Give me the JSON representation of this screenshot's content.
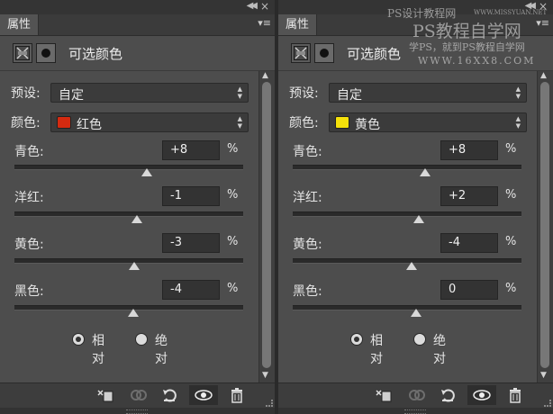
{
  "panels": [
    {
      "tab_label": "属性",
      "adjustment_title": "可选颜色",
      "preset_label": "预设:",
      "preset_value": "自定",
      "color_label": "颜色:",
      "color_value": "红色",
      "swatch_color": "#d42a10",
      "sliders": [
        {
          "label": "青色:",
          "value": "+8",
          "unit": "%",
          "level_pct": 8
        },
        {
          "label": "洋红:",
          "value": "-1",
          "unit": "%",
          "level_pct": -1
        },
        {
          "label": "黄色:",
          "value": "-3",
          "unit": "%",
          "level_pct": -3
        },
        {
          "label": "黑色:",
          "value": "-4",
          "unit": "%",
          "level_pct": -4
        }
      ],
      "method_options": [
        {
          "label": "相对",
          "checked": true
        },
        {
          "label": "绝对",
          "checked": false
        }
      ],
      "footer_icons": [
        "clip-to-layer-icon",
        "view-previous-state-icon",
        "reset-icon",
        "visibility-eye-icon",
        "delete-trash-icon"
      ]
    },
    {
      "tab_label": "属性",
      "adjustment_title": "可选颜色",
      "preset_label": "预设:",
      "preset_value": "自定",
      "color_label": "颜色:",
      "color_value": "黄色",
      "swatch_color": "#f5e10a",
      "sliders": [
        {
          "label": "青色:",
          "value": "+8",
          "unit": "%",
          "level_pct": 8
        },
        {
          "label": "洋红:",
          "value": "+2",
          "unit": "%",
          "level_pct": 2
        },
        {
          "label": "黄色:",
          "value": "-4",
          "unit": "%",
          "level_pct": -4
        },
        {
          "label": "黑色:",
          "value": "0",
          "unit": "%",
          "level_pct": 0
        }
      ],
      "method_options": [
        {
          "label": "相对",
          "checked": true
        },
        {
          "label": "绝对",
          "checked": false
        }
      ],
      "footer_icons": [
        "clip-to-layer-icon",
        "view-previous-state-icon",
        "reset-icon",
        "visibility-eye-icon",
        "delete-trash-icon"
      ]
    }
  ],
  "watermark": {
    "line1": "PS设计教程网",
    "line1_small": "WWW.MISSYUAN.NET",
    "line2": "PS教程自学网",
    "line3": "学PS，就到PS教程自学网",
    "line4": "WWW.16XX8.COM"
  }
}
